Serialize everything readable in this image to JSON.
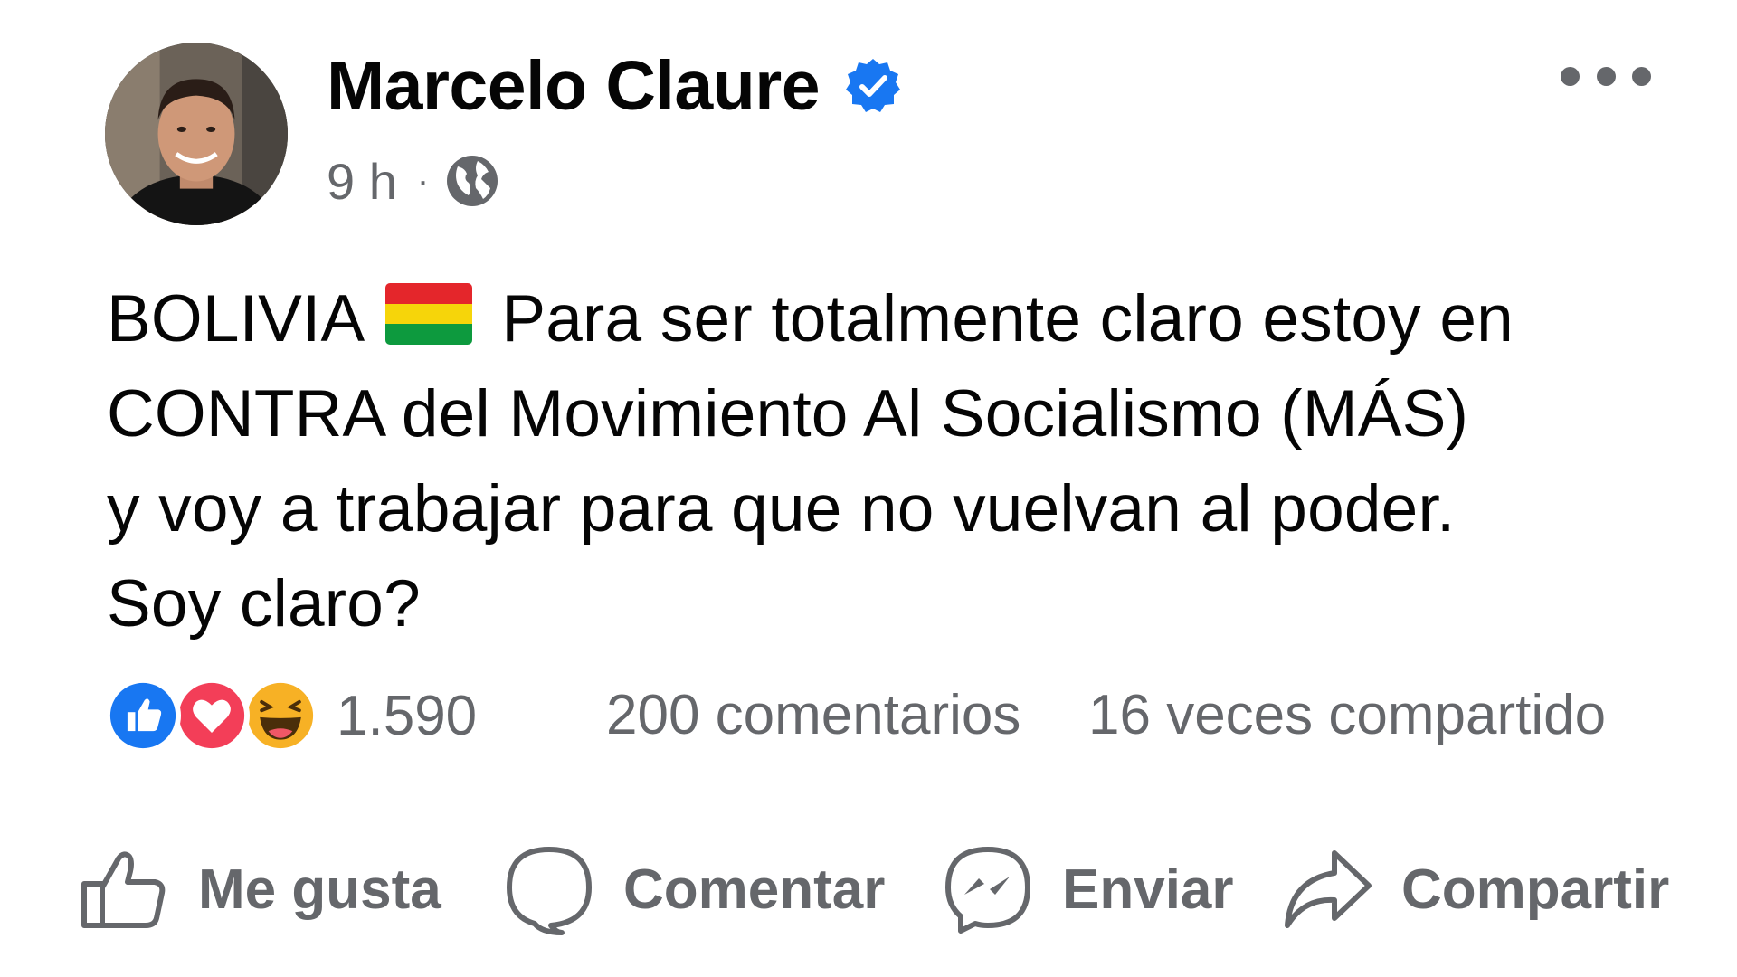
{
  "post": {
    "author": {
      "name": "Marcelo Claure",
      "verified": true
    },
    "timestamp": "9 h",
    "separator": "·",
    "audience_icon": "globe-icon",
    "menu_icon": "more-options-icon",
    "text_lines": [
      {
        "before_flag": "BOLIVIA",
        "after_flag": "Para ser totalmente claro estoy en"
      },
      "CONTRA del Movimiento Al Socialismo (MÁS)",
      "y voy a trabajar para que no vuelvan al poder.",
      "Soy claro?"
    ],
    "flag_emoji": "bolivia-flag-emoji"
  },
  "engagement": {
    "reaction_icons": [
      "like-reaction-icon",
      "love-reaction-icon",
      "haha-reaction-icon"
    ],
    "reactions_count": "1.590",
    "comments": "200 comentarios",
    "shares": "16 veces compartido"
  },
  "actions": {
    "like": "Me gusta",
    "comment": "Comentar",
    "send": "Enviar",
    "share": "Compartir"
  },
  "colors": {
    "text": "#050505",
    "secondary": "#65676b",
    "verified_blue": "#1877f2",
    "like_blue": "#1877f2",
    "love_red": "#f33e58",
    "haha_yellow": "#f7b125"
  }
}
